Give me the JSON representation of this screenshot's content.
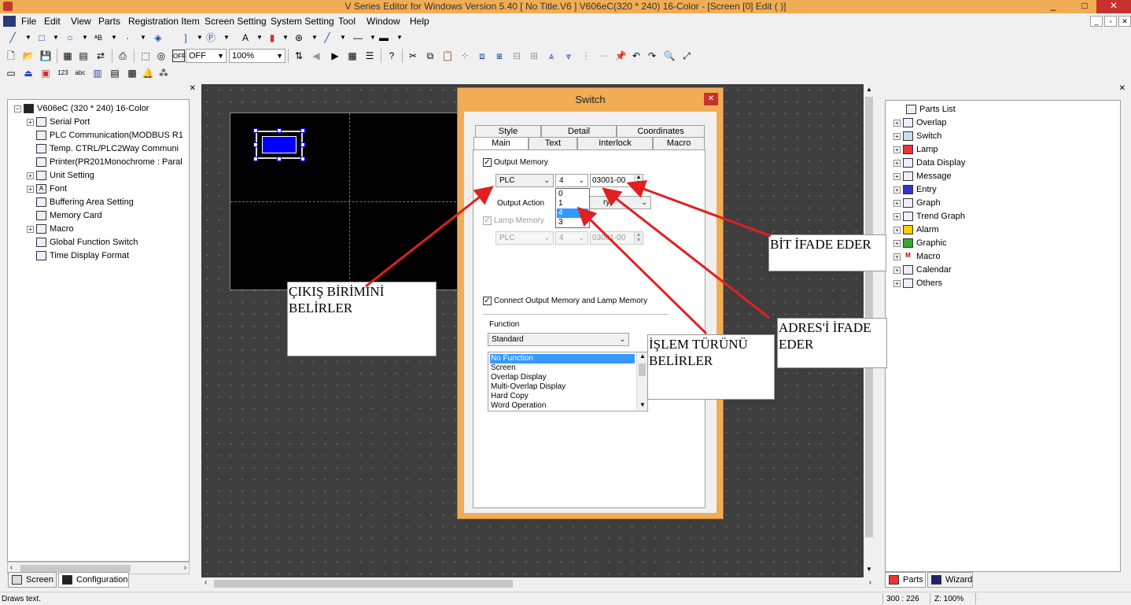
{
  "window": {
    "title": "V Series Editor for Windows Version 5.40 [ No Title.V6 ] V606eC(320 * 240) 16-Color - [Screen [0] Edit (               )]",
    "minimize": "_",
    "restore": "□",
    "close": "✕"
  },
  "menu": {
    "items": [
      "File",
      "Edit",
      "View",
      "Parts",
      "Registration Item",
      "Screen Setting",
      "System Setting",
      "Tool",
      "Window",
      "Help"
    ],
    "mdi_minimize": "_",
    "mdi_restore": "▫",
    "mdi_close": "✕"
  },
  "toolbar": {
    "off_label": "OFF",
    "zoom_value": "100%"
  },
  "left_panel": {
    "tree": [
      {
        "label": "V606eC (320 * 240) 16-Color",
        "icon": "monitor-icon"
      },
      {
        "label": "Serial Port",
        "icon": "serial-icon"
      },
      {
        "label": "PLC Communication(MODBUS R1",
        "icon": "plc-icon"
      },
      {
        "label": "Temp. CTRL/PLC2Way Communi",
        "icon": "temp-icon"
      },
      {
        "label": "Printer(PR201Monochrome : Paral",
        "icon": "printer-icon"
      },
      {
        "label": "Unit Setting",
        "icon": "unit-icon"
      },
      {
        "label": "Font",
        "icon": "font-icon"
      },
      {
        "label": "Buffering Area Setting",
        "icon": "buffer-icon"
      },
      {
        "label": "Memory Card",
        "icon": "memcard-icon"
      },
      {
        "label": "Macro",
        "icon": "macro-icon"
      },
      {
        "label": "Global Function Switch",
        "icon": "switch-icon"
      },
      {
        "label": "Time Display Format",
        "icon": "clock-icon"
      }
    ],
    "tabs": [
      "Screen",
      "Configuration"
    ]
  },
  "right_panel": {
    "tree": [
      {
        "label": "Parts List",
        "icon": "parts-list-icon"
      },
      {
        "label": "Overlap",
        "icon": "overlap-icon"
      },
      {
        "label": "Switch",
        "icon": "switch-icon"
      },
      {
        "label": "Lamp",
        "icon": "lamp-icon"
      },
      {
        "label": "Data Display",
        "icon": "data-display-icon"
      },
      {
        "label": "Message",
        "icon": "message-icon"
      },
      {
        "label": "Entry",
        "icon": "entry-icon"
      },
      {
        "label": "Graph",
        "icon": "graph-icon"
      },
      {
        "label": "Trend Graph",
        "icon": "trend-graph-icon"
      },
      {
        "label": "Alarm",
        "icon": "alarm-icon"
      },
      {
        "label": "Graphic",
        "icon": "graphic-icon"
      },
      {
        "label": "Macro",
        "icon": "macro-icon"
      },
      {
        "label": "Calendar",
        "icon": "calendar-icon"
      },
      {
        "label": "Others",
        "icon": "others-icon"
      }
    ],
    "tabs": [
      "Parts",
      "Wizard"
    ]
  },
  "dialog": {
    "title": "Switch",
    "close": "✕",
    "tabs_back": [
      "Style",
      "Detail",
      "Coordinates"
    ],
    "tabs_front": [
      "Main",
      "Text",
      "Interlock",
      "Macro"
    ],
    "output_memory_label": "Output Memory",
    "output_memory_type": "PLC",
    "output_memory_bit": "4",
    "output_memory_address": "03001-00",
    "bit_options": [
      "0",
      "1",
      "4",
      "3"
    ],
    "output_action_label": "Output Action",
    "output_action_value": "ry",
    "lamp_memory_label": "Lamp Memory",
    "lamp_memory_type": "PLC",
    "lamp_memory_bit": "4",
    "lamp_memory_address": "03001-00",
    "connect_label": "Connect Output Memory and Lamp Memory",
    "function_label": "Function",
    "function_value": "Standard",
    "function_list": [
      "No Function",
      "Screen",
      "Overlap Display",
      "Multi-Overlap Display",
      "Hard Copy",
      "Word Operation"
    ]
  },
  "annotations": {
    "output_unit": [
      "ÇIKIŞ BİRİMİNİ",
      "BELİRLER"
    ],
    "operation_type": [
      "İŞLEM TÜRÜNÜ",
      "BELİRLER"
    ],
    "address": [
      "ADRES'İ İFADE",
      "EDER"
    ],
    "bit": [
      "BİT İFADE EDER"
    ]
  },
  "status": {
    "message": "Draws text.",
    "coords": "300 : 226",
    "zoom": "Z: 100%"
  },
  "colors": {
    "titlebar": "#f1ad55",
    "dialog_frame": "#f1ad55",
    "close_button": "#c7312e",
    "canvas": "#3e3e3e",
    "switch_fill": "#0000ff",
    "annotation_arrow": "#e02020",
    "selection": "#3399ff"
  }
}
